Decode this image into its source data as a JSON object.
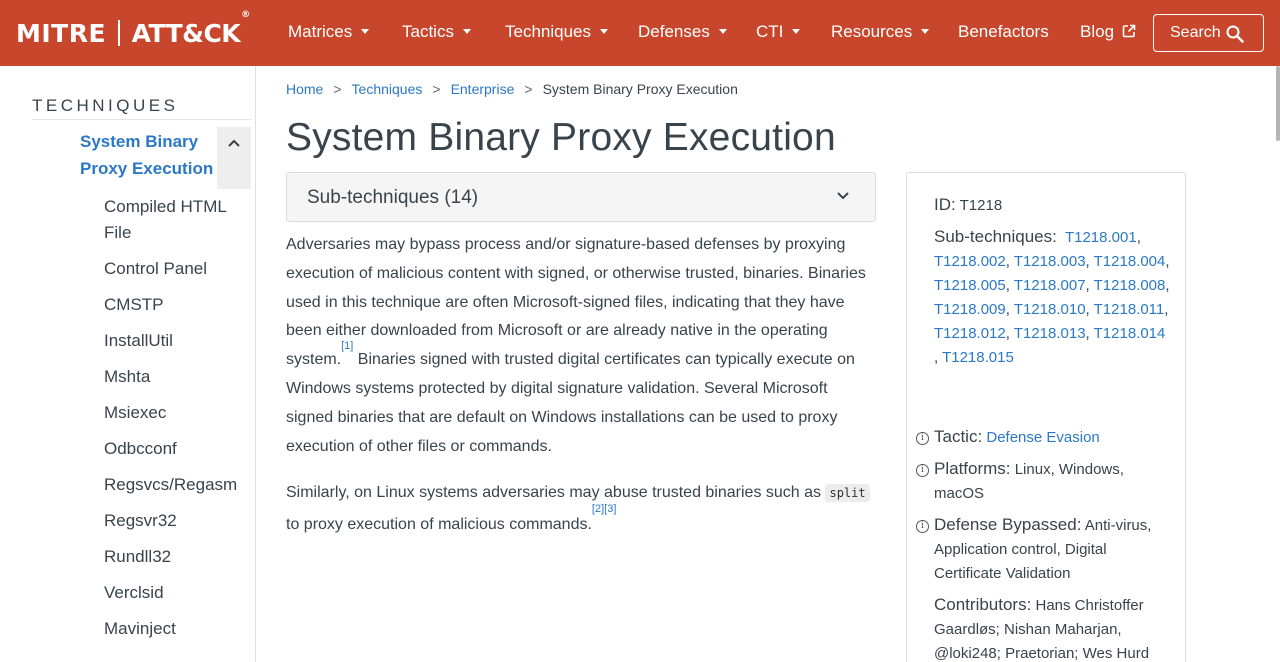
{
  "nav": {
    "brand_mitre": "MITRE",
    "brand_attck": "ATT&CK",
    "brand_reg": "®",
    "items": [
      {
        "label": "Matrices",
        "dropdown": true
      },
      {
        "label": "Tactics",
        "dropdown": true
      },
      {
        "label": "Techniques",
        "dropdown": true
      },
      {
        "label": "Defenses",
        "dropdown": true
      },
      {
        "label": "CTI",
        "dropdown": true
      },
      {
        "label": "Resources",
        "dropdown": true
      },
      {
        "label": "Benefactors",
        "dropdown": false
      },
      {
        "label": "Blog",
        "dropdown": false,
        "external": true
      }
    ],
    "search_label": "Search"
  },
  "sidebar": {
    "title": "TECHNIQUES",
    "active_item": "System Binary Proxy Execution",
    "sub_items": [
      "Compiled HTML File",
      "Control Panel",
      "CMSTP",
      "InstallUtil",
      "Mshta",
      "Msiexec",
      "Odbcconf",
      "Regsvcs/Regasm",
      "Regsvr32",
      "Rundll32",
      "Verclsid",
      "Mavinject"
    ]
  },
  "breadcrumb": {
    "items": [
      "Home",
      "Techniques",
      "Enterprise"
    ],
    "current": "System Binary Proxy Execution",
    "separator": ">"
  },
  "main": {
    "title": "System Binary Proxy Execution",
    "subtechniques_label": "Sub-techniques (14)",
    "desc_p1_a": "Adversaries may bypass process and/or signature-based defenses by proxying execution of malicious content with signed, or otherwise trusted, binaries. Binaries used in this technique are often Microsoft-signed files, indicating that they have been either downloaded from Microsoft or are already native in the operating system.",
    "cite1": "[1]",
    "desc_p1_b": " Binaries signed with trusted digital certificates can typically execute on Windows systems protected by digital signature validation. Several Microsoft signed binaries that are default on Windows installations can be used to proxy execution of other files or commands.",
    "desc_p2_a": "Similarly, on Linux systems adversaries may abuse trusted binaries such as ",
    "desc_p2_code": "split",
    "desc_p2_b": " to proxy execution of malicious commands.",
    "cite23": "[2][3]"
  },
  "info": {
    "id_key": "ID:",
    "id_value": "T1218",
    "subtech_key": "Sub-techniques:",
    "subtech_ids": [
      "T1218.001",
      "T1218.002",
      "T1218.003",
      "T1218.004",
      "T1218.005",
      "T1218.007",
      "T1218.008",
      "T1218.009",
      "T1218.010",
      "T1218.011",
      "T1218.012",
      "T1218.013",
      "T1218.014",
      "T1218.015"
    ],
    "tactic_key": "Tactic:",
    "tactic_value": "Defense Evasion",
    "platforms_key": "Platforms:",
    "platforms_value": "Linux, Windows, macOS",
    "defense_key": "Defense Bypassed:",
    "defense_value": "Anti-virus, Application control, Digital Certificate Validation",
    "contributors_key": "Contributors:",
    "contributors_value": "Hans Christoffer Gaardløs; Nishan Maharjan, @loki248; Praetorian; Wes Hurd"
  },
  "colors": {
    "navbar_bg": "#c8462c",
    "link": "#2a78c7",
    "text": "#39434c"
  }
}
